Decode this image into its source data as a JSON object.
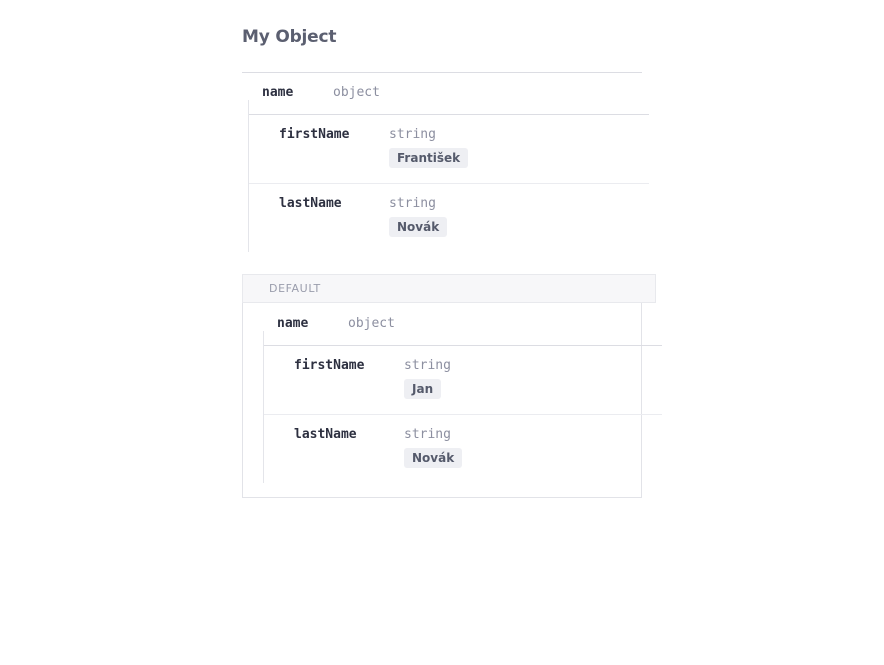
{
  "title": "My Object",
  "schema": {
    "root": {
      "name": "name",
      "type": "object"
    },
    "properties": [
      {
        "name": "firstName",
        "type": "string",
        "value": "František"
      },
      {
        "name": "lastName",
        "type": "string",
        "value": "Novák"
      }
    ]
  },
  "default_section": {
    "label": "DEFAULT",
    "root": {
      "name": "name",
      "type": "object"
    },
    "properties": [
      {
        "name": "firstName",
        "type": "string",
        "value": "Jan"
      },
      {
        "name": "lastName",
        "type": "string",
        "value": "Novák"
      }
    ]
  }
}
